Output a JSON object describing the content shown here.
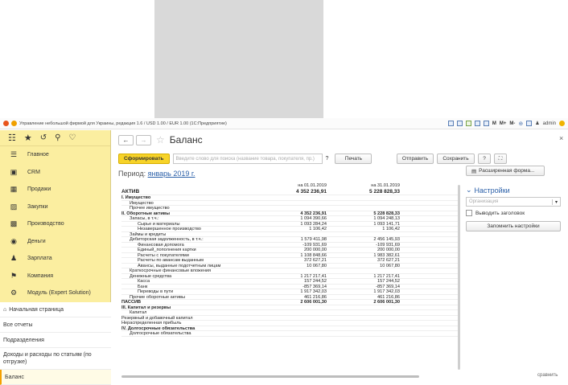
{
  "window": {
    "title": "Управление небольшой фирмой для Украины, редакция 1.6 / USD 1.00 / EUR 1.00  (1С:Предприятие)",
    "toolbar_labels": [
      "M",
      "M+",
      "M-"
    ],
    "user": "admin"
  },
  "sidebar": {
    "items": [
      {
        "label": "Главное",
        "icon": "list-icon"
      },
      {
        "label": "CRM",
        "icon": "crm-icon"
      },
      {
        "label": "Продажи",
        "icon": "sales-icon"
      },
      {
        "label": "Закупки",
        "icon": "purchase-icon"
      },
      {
        "label": "Производство",
        "icon": "production-icon"
      },
      {
        "label": "Деньги",
        "icon": "money-icon"
      },
      {
        "label": "Зарплата",
        "icon": "salary-icon"
      },
      {
        "label": "Компания",
        "icon": "company-icon"
      },
      {
        "label": "Модуль (Expert Solution)",
        "icon": "module-icon"
      }
    ],
    "links": [
      {
        "label": "Начальная страница"
      },
      {
        "label": "Все отчеты"
      },
      {
        "label": "Подразделения"
      },
      {
        "label": "Доходы и расходы по статьям (по отгрузке)"
      },
      {
        "label": "Баланс"
      }
    ]
  },
  "main": {
    "title": "Баланс",
    "generate_label": "Сформировать",
    "search_placeholder": "Введите слово для поиска (название товара, покупателя, пр.)",
    "search_help": "?",
    "print_label": "Печать",
    "send_label": "Отправить",
    "save_label": "Сохранить",
    "help_label": "?",
    "period_label": "Период:",
    "period_value": "январь 2019 г.",
    "advanced_form_label": "Расширенная форма...",
    "settings_title": "Настройки",
    "organization_placeholder": "Организация",
    "show_headers_label": "Выводить заголовок",
    "remember_settings_label": "Запомнить настройки",
    "bottom_right_label": "сравнить"
  },
  "report": {
    "header": {
      "col1": "на 01.01.2019",
      "col2": "на 31.01.2019",
      "label": "АКТИВ",
      "total1": "4 352 236,91",
      "total2": "5 228 828,33"
    },
    "rows": [
      {
        "label": "I. Имущество",
        "v1": "",
        "v2": "",
        "bold": true,
        "indent": 0
      },
      {
        "label": "Имущество",
        "v1": "",
        "v2": "",
        "bold": false,
        "indent": 1
      },
      {
        "label": "Прочее имущество",
        "v1": "",
        "v2": "",
        "bold": false,
        "indent": 1
      },
      {
        "label": "II. Оборотные активы",
        "v1": "4 352 236,91",
        "v2": "5 228 828,33",
        "bold": true,
        "indent": 0
      },
      {
        "label": "Запасы, в т.ч.:",
        "v1": "1 094 390,66",
        "v2": "1 094 248,13",
        "bold": false,
        "indent": 1
      },
      {
        "label": "Сырье и материалы",
        "v1": "1 093 284,24",
        "v2": "1 093 141,71",
        "bold": false,
        "indent": 2
      },
      {
        "label": "Незавершенное производство",
        "v1": "1 106,42",
        "v2": "1 106,42",
        "bold": false,
        "indent": 2
      },
      {
        "label": "Займы и кредиты",
        "v1": "",
        "v2": "",
        "bold": false,
        "indent": 1
      },
      {
        "label": "Дебиторская задолженность, в т.ч.:",
        "v1": "1 579 411,98",
        "v2": "2 456 145,93",
        "bold": false,
        "indent": 1
      },
      {
        "label": "Финансовая допомога",
        "v1": "-109 931,69",
        "v2": "-109 931,69",
        "bold": false,
        "indent": 2
      },
      {
        "label": "Единый_пополнения картки",
        "v1": "200 000,00",
        "v2": "200 000,00",
        "bold": false,
        "indent": 2
      },
      {
        "label": "Расчеты с покупателями",
        "v1": "1 108 848,66",
        "v2": "1 983 382,61",
        "bold": false,
        "indent": 2
      },
      {
        "label": "Расчеты по авансам выданным",
        "v1": "372 627,21",
        "v2": "372 627,21",
        "bold": false,
        "indent": 2
      },
      {
        "label": "Авансы, выданные подотчетным лицам",
        "v1": "10 067,80",
        "v2": "10 067,80",
        "bold": false,
        "indent": 2
      },
      {
        "label": "Краткосрочные финансовые вложения",
        "v1": "",
        "v2": "",
        "bold": false,
        "indent": 1
      },
      {
        "label": "Денежные средства",
        "v1": "1 217 217,41",
        "v2": "1 217 217,41",
        "bold": false,
        "indent": 1
      },
      {
        "label": "Касса",
        "v1": "157 244,52",
        "v2": "157 244,52",
        "bold": false,
        "indent": 2
      },
      {
        "label": "Банк",
        "v1": "-857 369,14",
        "v2": "-857 369,14",
        "bold": false,
        "indent": 2
      },
      {
        "label": "Переводы в пути",
        "v1": "1 917 342,03",
        "v2": "1 917 342,03",
        "bold": false,
        "indent": 2
      },
      {
        "label": "Прочие оборотные активы",
        "v1": "461 216,86",
        "v2": "461 216,86",
        "bold": false,
        "indent": 1
      },
      {
        "label": "ПАССИВ",
        "v1": "2 606 001,30",
        "v2": "2 606 001,30",
        "bold": true,
        "indent": 0
      },
      {
        "label": "III. Капитал и резервы",
        "v1": "",
        "v2": "",
        "bold": true,
        "indent": 0
      },
      {
        "label": "Капитал",
        "v1": "",
        "v2": "",
        "bold": false,
        "indent": 1
      },
      {
        "label": "Резервный и добавочный капитал",
        "v1": "",
        "v2": "",
        "bold": false,
        "indent": 0
      },
      {
        "label": "Нераспределенная прибыль",
        "v1": "",
        "v2": "",
        "bold": false,
        "indent": 0
      },
      {
        "label": "IV. Долгосрочные обязательства",
        "v1": "",
        "v2": "",
        "bold": true,
        "indent": 0
      },
      {
        "label": "Долгосрочные обязательства",
        "v1": "",
        "v2": "",
        "bold": false,
        "indent": 1
      }
    ]
  },
  "colors": {
    "sidebar_bg": "#fbeea0",
    "accent": "#f7d328",
    "link": "#2a5fa8"
  }
}
